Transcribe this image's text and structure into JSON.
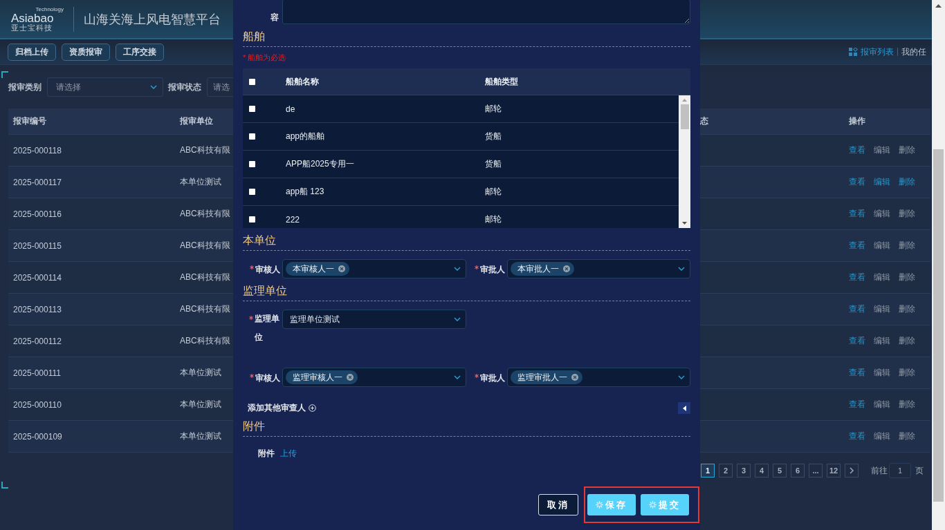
{
  "header": {
    "logo_tagline": "Technology",
    "logo_text": "Asiabao",
    "logo_subtitle": "亚士宝科技",
    "title": "山海关海上风电智慧平台"
  },
  "toolbar": [
    "归档上传",
    "资质报审",
    "工序交接"
  ],
  "nav": [
    {
      "label": "报审列表",
      "selected": true
    },
    {
      "label": "我的任",
      "selected": false
    }
  ],
  "filters": [
    {
      "label": "报审类别",
      "placeholder": "请选择"
    },
    {
      "label": "报审状态",
      "placeholder": "请选"
    }
  ],
  "table": {
    "columns": [
      "报审编号",
      "报审单位",
      "态",
      "操作"
    ],
    "rows": [
      {
        "number": "2025-000118",
        "unit": "ABC科技有限",
        "actions": [
          {
            "label": "查看",
            "highlighted": true
          },
          {
            "label": "编辑",
            "highlighted": false
          },
          {
            "label": "删除",
            "highlighted": false
          }
        ]
      },
      {
        "number": "2025-000117",
        "unit": "本单位测试",
        "actions": [
          {
            "label": "查看",
            "highlighted": true
          },
          {
            "label": "编辑",
            "highlighted": true
          },
          {
            "label": "删除",
            "highlighted": true
          }
        ]
      },
      {
        "number": "2025-000116",
        "unit": "ABC科技有限",
        "actions": [
          {
            "label": "查看",
            "highlighted": true
          },
          {
            "label": "编辑",
            "highlighted": false
          },
          {
            "label": "删除",
            "highlighted": false
          }
        ]
      },
      {
        "number": "2025-000115",
        "unit": "ABC科技有限",
        "actions": [
          {
            "label": "查看",
            "highlighted": true
          },
          {
            "label": "编辑",
            "highlighted": false
          },
          {
            "label": "删除",
            "highlighted": false
          }
        ]
      },
      {
        "number": "2025-000114",
        "unit": "ABC科技有限",
        "actions": [
          {
            "label": "查看",
            "highlighted": true
          },
          {
            "label": "编辑",
            "highlighted": false
          },
          {
            "label": "删除",
            "highlighted": false
          }
        ]
      },
      {
        "number": "2025-000113",
        "unit": "ABC科技有限",
        "actions": [
          {
            "label": "查看",
            "highlighted": true
          },
          {
            "label": "编辑",
            "highlighted": false
          },
          {
            "label": "删除",
            "highlighted": false
          }
        ]
      },
      {
        "number": "2025-000112",
        "unit": "ABC科技有限",
        "actions": [
          {
            "label": "查看",
            "highlighted": true
          },
          {
            "label": "编辑",
            "highlighted": false
          },
          {
            "label": "删除",
            "highlighted": false
          }
        ]
      },
      {
        "number": "2025-000111",
        "unit": "本单位测试",
        "actions": [
          {
            "label": "查看",
            "highlighted": true
          },
          {
            "label": "编辑",
            "highlighted": false
          },
          {
            "label": "删除",
            "highlighted": false
          }
        ]
      },
      {
        "number": "2025-000110",
        "unit": "本单位测试",
        "actions": [
          {
            "label": "查看",
            "highlighted": true
          },
          {
            "label": "编辑",
            "highlighted": false
          },
          {
            "label": "删除",
            "highlighted": false
          }
        ]
      },
      {
        "number": "2025-000109",
        "unit": "本单位测试",
        "actions": [
          {
            "label": "查看",
            "highlighted": true
          },
          {
            "label": "编辑",
            "highlighted": false
          },
          {
            "label": "删除",
            "highlighted": false
          }
        ]
      }
    ]
  },
  "pagination": {
    "pages": [
      {
        "label": "1",
        "selected": true
      },
      {
        "label": "2",
        "selected": false
      },
      {
        "label": "3",
        "selected": false
      },
      {
        "label": "4",
        "selected": false
      },
      {
        "label": "5",
        "selected": false
      },
      {
        "label": "6",
        "selected": false
      },
      {
        "label": "...",
        "selected": false
      },
      {
        "label": "12",
        "selected": false
      }
    ],
    "goto_label": "前往",
    "goto_value": "1",
    "page_suffix": "页"
  },
  "dialog": {
    "top_field": {
      "label": "容"
    },
    "sections": [
      {
        "kind": "ships",
        "title": "船舶",
        "note": "* 船舶为必选",
        "all_checked": false,
        "columns": [
          "船舶名称",
          "船舶类型"
        ],
        "rows": [
          {
            "name": "de",
            "type": "邮轮",
            "checked": false
          },
          {
            "name": "app的船舶",
            "type": "货船",
            "checked": false
          },
          {
            "name": "APP船2025专用一",
            "type": "货船",
            "checked": false
          },
          {
            "name": "app船 123",
            "type": "邮轮",
            "checked": false
          },
          {
            "name": "222",
            "type": "邮轮",
            "checked": false
          }
        ]
      },
      {
        "kind": "reviewers",
        "title": "本单位",
        "fields": [
          {
            "label": "审核人",
            "required": true,
            "tags": [
              "本审核人一"
            ]
          },
          {
            "label": "审批人",
            "required": true,
            "tags": [
              "本审批人一"
            ]
          }
        ]
      },
      {
        "kind": "supervision",
        "title": "监理单位",
        "unit": {
          "label": "监理单位",
          "required": true,
          "value": "监理单位测试"
        },
        "fields": [
          {
            "label": "审核人",
            "required": true,
            "tags": [
              "监理审核人一"
            ]
          },
          {
            "label": "审批人",
            "required": true,
            "tags": [
              "监理审批人一"
            ]
          }
        ],
        "add_label": "添加其他审查人"
      },
      {
        "kind": "attachments",
        "title": "附件",
        "label": "附件",
        "link": "上传"
      }
    ],
    "buttons": [
      {
        "label": "取消",
        "kind": "secondary"
      },
      {
        "label": "保存",
        "kind": "primary"
      },
      {
        "label": "提交",
        "kind": "primary"
      }
    ]
  }
}
